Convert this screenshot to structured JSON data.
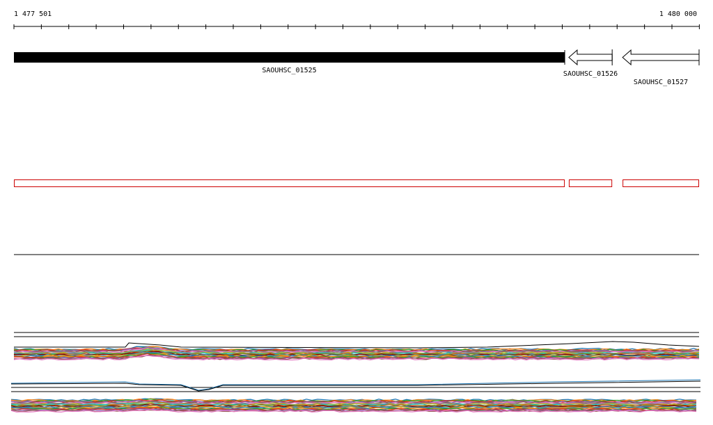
{
  "ruler": {
    "start_label": "1 477 501",
    "end_label": "1 480 000",
    "start": 1477501,
    "end": 1480000,
    "major_tick_step": 100
  },
  "genes": [
    {
      "id": "SAOUHSC_01525",
      "start": 1477501,
      "end": 1479510,
      "strand": "+",
      "selected": true
    },
    {
      "id": "SAOUHSC_01526",
      "start": 1479525,
      "end": 1479683,
      "strand": "-",
      "selected": false
    },
    {
      "id": "SAOUHSC_01527",
      "start": 1479721,
      "end": 1480000,
      "strand": "-",
      "selected": false
    }
  ],
  "colors": {
    "selected_gene": "#000000",
    "gene_outline": "#000000",
    "feature_box": "#cc0000",
    "axis": "#000000",
    "profile_palette": [
      "#1f77b4",
      "#ff7f0e",
      "#2ca02c",
      "#d62728",
      "#9467bd",
      "#8c564b",
      "#e377c2",
      "#7f7f7f",
      "#bcbd22",
      "#17becf",
      "#c85a1a",
      "#6b8e23",
      "#800000",
      "#4682b4",
      "#daa520"
    ]
  }
}
